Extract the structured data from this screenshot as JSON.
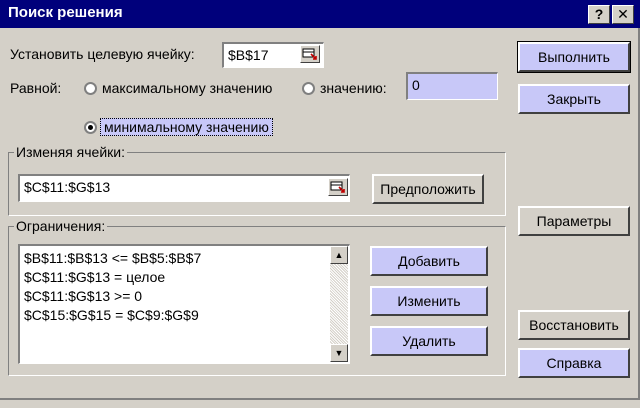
{
  "window": {
    "title": "Поиск решения",
    "help_glyph": "?",
    "close_glyph": "✕"
  },
  "target": {
    "label": "Установить целевую ячейку:",
    "value": "$B$17"
  },
  "equal": {
    "label": "Равной:",
    "max_label": "максимальному значению",
    "value_label": "значению:",
    "value": "0",
    "min_label": "минимальному значению",
    "selected": "min"
  },
  "changing": {
    "group_label": "Изменяя ячейки:",
    "value": "$C$11:$G$13",
    "guess_button": "Предположить"
  },
  "constraints": {
    "group_label": "Ограничения:",
    "items": [
      "$B$11:$B$13 <= $B$5:$B$7",
      "$C$11:$G$13 = целое",
      "$C$11:$G$13 >= 0",
      "$C$15:$G$15 = $C$9:$G$9"
    ],
    "add_button": "Добавить",
    "change_button": "Изменить",
    "delete_button": "Удалить"
  },
  "buttons": {
    "solve": "Выполнить",
    "close": "Закрыть",
    "options": "Параметры",
    "reset": "Восстановить",
    "help": "Справка"
  },
  "colors": {
    "titlebar": "#00007b",
    "face": "#d4d0c8",
    "highlight": "#c8c8f8"
  }
}
